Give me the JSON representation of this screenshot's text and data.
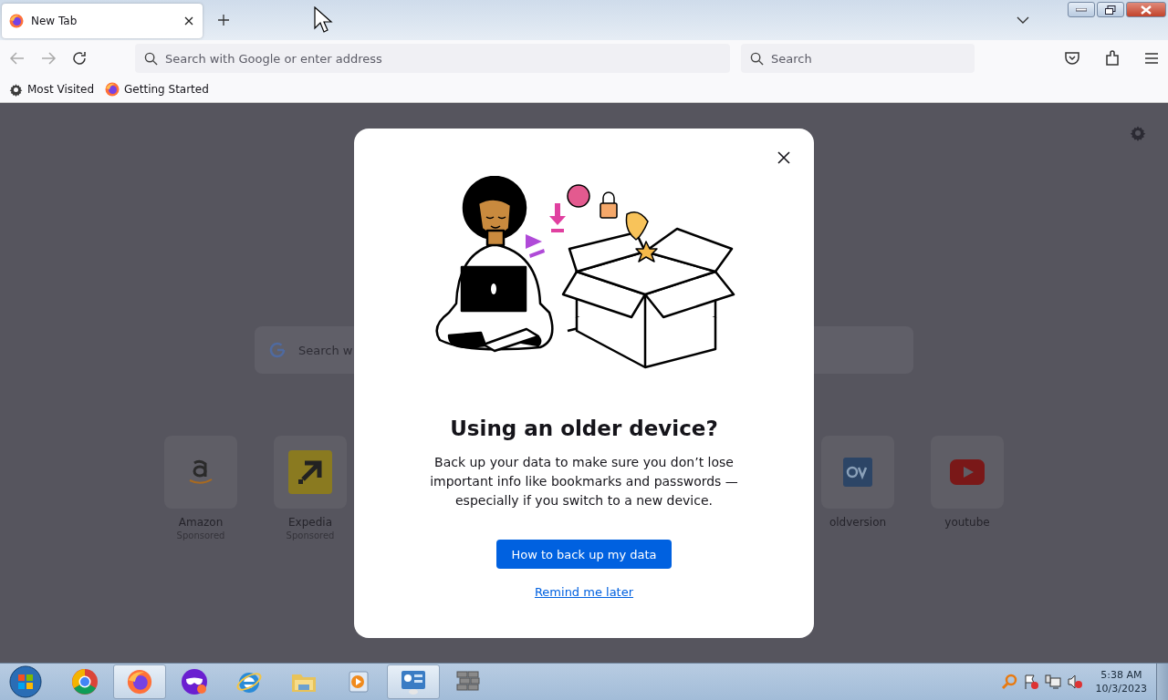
{
  "tabs": [
    {
      "title": "New Tab",
      "selected": true
    }
  ],
  "toolbar": {
    "address_placeholder": "Search with Google or enter address",
    "search_placeholder": "Search"
  },
  "bookmarks": [
    {
      "kind": "gear",
      "label": "Most Visited"
    },
    {
      "kind": "firefox",
      "label": "Getting Started"
    }
  ],
  "new_tab": {
    "search_placeholder": "Search w",
    "shortcuts_left": [
      {
        "kind": "amazon",
        "name": "Amazon",
        "sponsored": "Sponsored"
      },
      {
        "kind": "expedia",
        "name": "Expedia",
        "sponsored": "Sponsored"
      }
    ],
    "shortcuts_right": [
      {
        "kind": "ov",
        "name": "oldversion"
      },
      {
        "kind": "youtube",
        "name": "youtube"
      }
    ]
  },
  "dialog": {
    "title": "Using an older device?",
    "body": "Back up your data to make sure you don’t lose important info like bookmarks and passwords — especially if you switch to a new device.",
    "primary_button": "How to back up my data",
    "link": "Remind me later"
  },
  "taskbar": {
    "apps": [
      {
        "kind": "chrome",
        "selected": false
      },
      {
        "kind": "firefox",
        "selected": true
      },
      {
        "kind": "mask",
        "selected": false
      },
      {
        "kind": "ie",
        "selected": false
      },
      {
        "kind": "folder",
        "selected": false
      },
      {
        "kind": "media",
        "selected": false
      },
      {
        "kind": "panel",
        "selected": true
      },
      {
        "kind": "wall",
        "selected": false
      }
    ],
    "time": "5:38 AM",
    "date": "10/3/2023"
  }
}
